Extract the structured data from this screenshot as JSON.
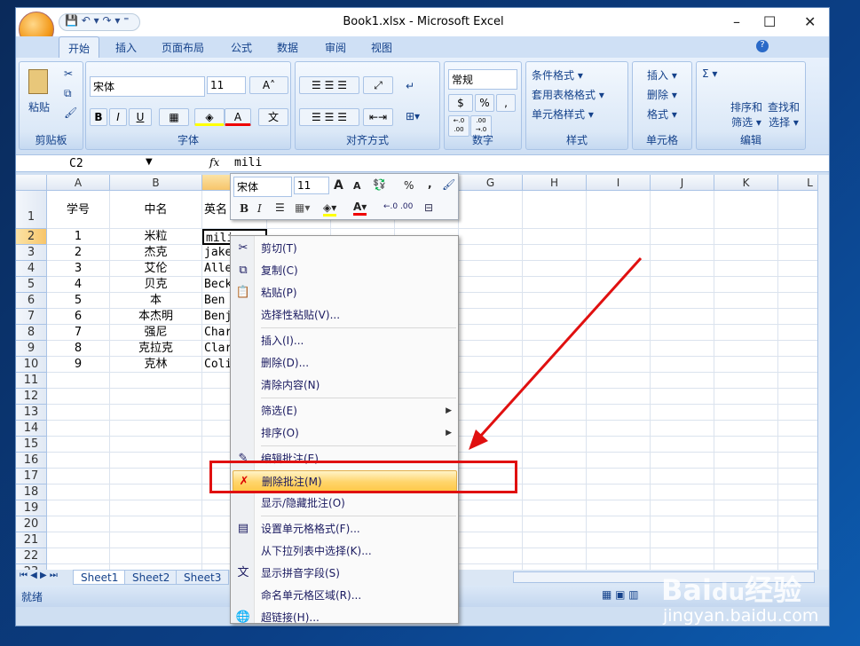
{
  "window": {
    "title": "Book1.xlsx - Microsoft Excel",
    "min": "–",
    "max": "☐",
    "close": "✕"
  },
  "qat": "💾 ↶ ▾ ↷ ▾ ⁼",
  "tabs": [
    "开始",
    "插入",
    "页面布局",
    "公式",
    "数据",
    "审阅",
    "视图"
  ],
  "ribbon": {
    "clipboard": {
      "label": "剪贴板",
      "paste": "粘贴"
    },
    "font": {
      "label": "字体",
      "name": "宋体",
      "size": "11",
      "bold": "B",
      "italic": "I",
      "underline": "U",
      "grow": "A˄",
      "shrink": "A˅"
    },
    "alignment": {
      "label": "对齐方式"
    },
    "number": {
      "label": "数字",
      "format": "常规",
      "percent": "%",
      "comma": ",",
      "inc": "←.0 .00",
      "dec": ".00 →.0"
    },
    "styles": {
      "label": "样式",
      "items": [
        "条件格式 ▾",
        "套用表格格式 ▾",
        "单元格样式 ▾"
      ]
    },
    "cells": {
      "label": "单元格",
      "items": [
        "插入 ▾",
        "删除 ▾",
        "格式 ▾"
      ]
    },
    "editing": {
      "label": "编辑",
      "sort": "排序和筛选 ▾",
      "find": "查找和选择 ▾",
      "sum": "Σ ▾"
    }
  },
  "formula_bar": {
    "name_box": "C2",
    "fx": "fx",
    "value": "mili"
  },
  "columns": [
    "A",
    "B",
    "C",
    "D",
    "E",
    "F",
    "G",
    "H",
    "I",
    "J",
    "K",
    "L"
  ],
  "rows": [
    "1",
    "2",
    "3",
    "4",
    "5",
    "6",
    "7",
    "8",
    "9",
    "10",
    "11",
    "12",
    "13",
    "14",
    "15",
    "16",
    "17",
    "18",
    "19",
    "20",
    "21",
    "22",
    "23"
  ],
  "cells": [
    [
      "学号",
      "中名",
      "英名"
    ],
    [
      "1",
      "米粒",
      "mili"
    ],
    [
      "2",
      "杰克",
      "jake"
    ],
    [
      "3",
      "艾伦",
      "Alle"
    ],
    [
      "4",
      "贝克",
      "Beck"
    ],
    [
      "5",
      "本",
      "Ben"
    ],
    [
      "6",
      "本杰明",
      "Benj"
    ],
    [
      "7",
      "强尼",
      "Char"
    ],
    [
      "8",
      "克拉克",
      "Clar"
    ],
    [
      "9",
      "克林",
      "Coli"
    ]
  ],
  "mini_toolbar": {
    "font": "宋体",
    "size": "11",
    "grow": "A",
    "shrink": "A",
    "percent": "%",
    "comma": ",",
    "bold": "B",
    "italic": "I"
  },
  "context_menu": [
    {
      "label": "剪切(T)",
      "icon": "scissors-icon",
      "glyph": "✂"
    },
    {
      "label": "复制(C)",
      "icon": "copy-icon",
      "glyph": "⧉"
    },
    {
      "label": "粘贴(P)",
      "icon": "paste-icon",
      "glyph": "📋"
    },
    {
      "label": "选择性粘贴(V)..."
    },
    {
      "sep": true
    },
    {
      "label": "插入(I)..."
    },
    {
      "label": "删除(D)..."
    },
    {
      "label": "清除内容(N)"
    },
    {
      "sep": true
    },
    {
      "label": "筛选(E)",
      "submenu": true
    },
    {
      "label": "排序(O)",
      "submenu": true
    },
    {
      "sep": true
    },
    {
      "label": "编辑批注(E)",
      "icon": "edit-comment-icon",
      "glyph": "✎"
    },
    {
      "label": "删除批注(M)",
      "icon": "delete-comment-icon",
      "glyph": "✗",
      "highlight": true
    },
    {
      "label": "显示/隐藏批注(O)"
    },
    {
      "sep": true
    },
    {
      "label": "设置单元格格式(F)...",
      "icon": "format-cells-icon",
      "glyph": "▤"
    },
    {
      "label": "从下拉列表中选择(K)..."
    },
    {
      "label": "显示拼音字段(S)",
      "icon": "phonetic-icon",
      "glyph": "文"
    },
    {
      "label": "命名单元格区域(R)..."
    },
    {
      "label": "超链接(H)...",
      "icon": "hyperlink-icon",
      "glyph": "🌐"
    }
  ],
  "sheets": [
    "Sheet1",
    "Sheet2",
    "Sheet3"
  ],
  "status": "就绪",
  "watermark": {
    "logo": "Bai du 经验",
    "url": "jingyan.baidu.com"
  },
  "colors": {
    "highlight_box": "#e01010",
    "arrow": "#e01010",
    "menu_highlight": "#ffd56b"
  }
}
